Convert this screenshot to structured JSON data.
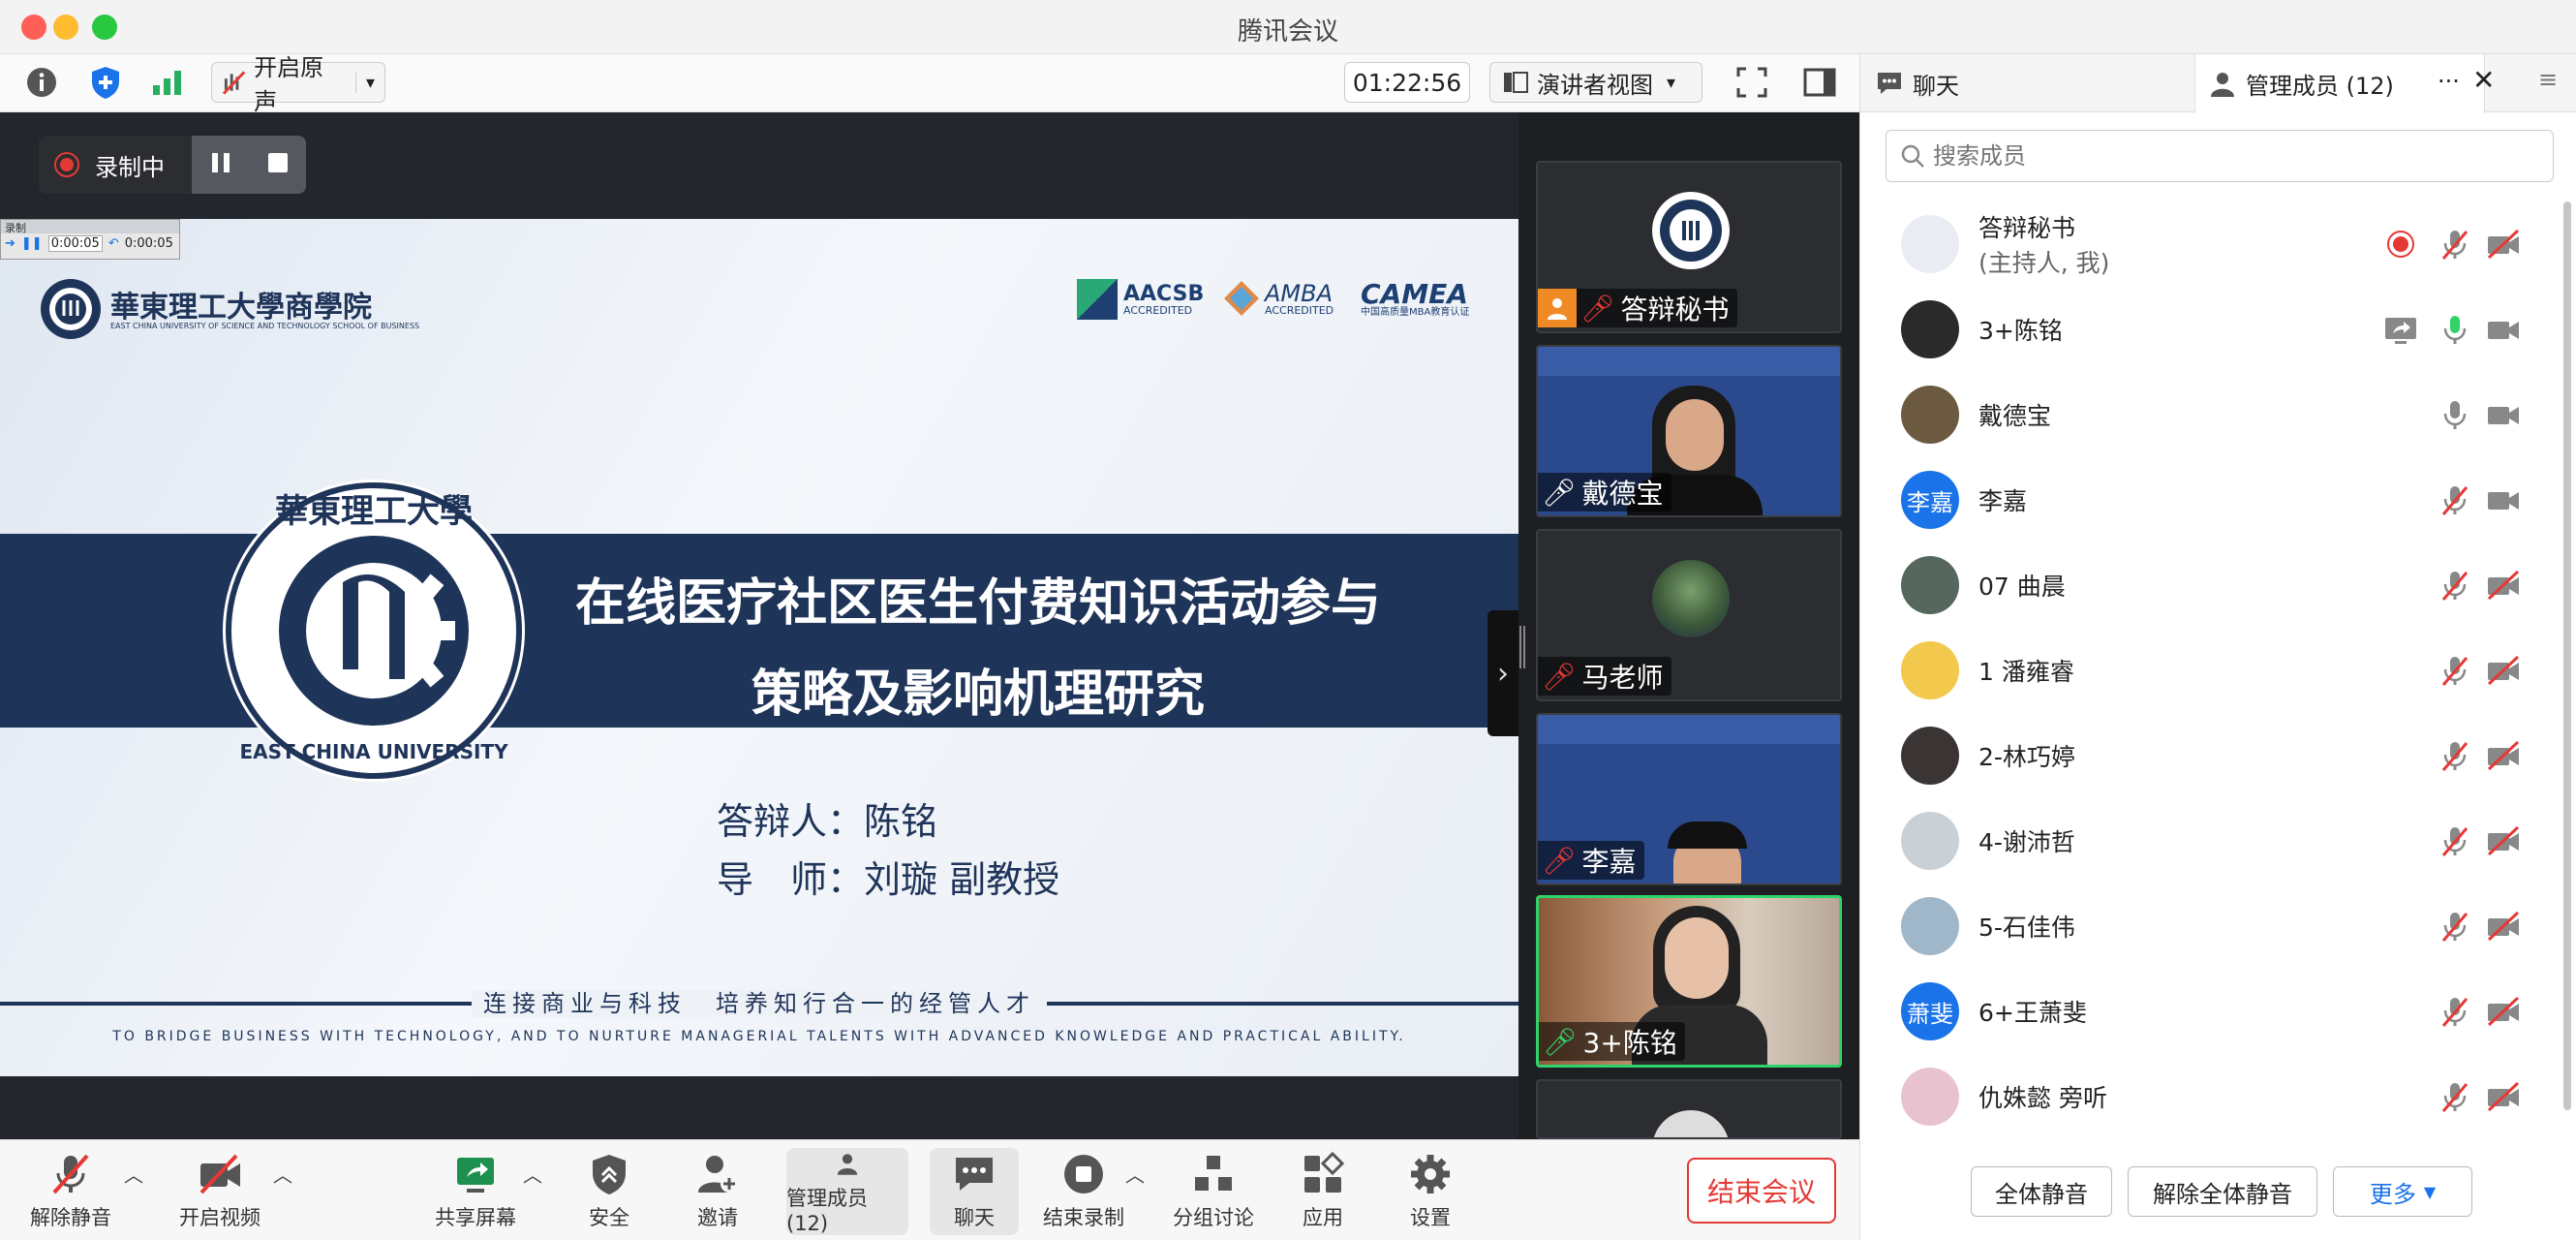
{
  "window": {
    "title": "腾讯会议"
  },
  "toolbar": {
    "original_sound": "开启原声",
    "timer": "01:22:56",
    "view_mode": "演讲者视图"
  },
  "recording": {
    "label": "录制中",
    "mini_label": "录制",
    "mini_time_a": "0:00:05",
    "mini_time_b": "0:00:05"
  },
  "slide": {
    "school_cn": "華東理工大學商學院",
    "school_en": "EAST CHINA UNIVERSITY OF SCIENCE AND TECHNOLOGY SCHOOL OF BUSINESS",
    "logo1": "AACSB",
    "logo1_sub": "ACCREDITED",
    "logo2": "AMBA",
    "logo2_sub": "ACCREDITED",
    "logo3": "CAMEA",
    "logo3_sub": "中国高质量MBA教育认证",
    "title_line1": "在线医疗社区医生付费知识活动参与",
    "title_line2": "策略及影响机理研究",
    "presenter": "答辩人：陈铭",
    "advisor": "导　师：刘璇  副教授",
    "motto_cn": "连接商业与科技　培养知行合一的经管人才",
    "motto_en": "TO BRIDGE BUSINESS WITH TECHNOLOGY, AND TO NURTURE MANAGERIAL TALENTS WITH ADVANCED KNOWLEDGE AND PRACTICAL ABILITY."
  },
  "tiles": [
    {
      "name": "答辩秘书"
    },
    {
      "name": "戴德宝"
    },
    {
      "name": "马老师"
    },
    {
      "name": "李嘉"
    },
    {
      "name": "3+陈铭"
    }
  ],
  "bottom": {
    "unmute": "解除静音",
    "video": "开启视频",
    "share": "共享屏幕",
    "security": "安全",
    "invite": "邀请",
    "members": "管理成员(12)",
    "chat": "聊天",
    "stop_rec": "结束录制",
    "breakout": "分组讨论",
    "apps": "应用",
    "settings": "设置",
    "end": "结束会议"
  },
  "sidebar": {
    "tab_chat": "聊天",
    "tab_members": "管理成员 (12)",
    "search_placeholder": "搜索成员",
    "members": [
      {
        "name": "答辩秘书",
        "sub": "(主持人, 我)",
        "avatar_color": "#e9edf3"
      },
      {
        "name": "3+陈铭",
        "sub": "",
        "avatar_color": "#2a2a2a"
      },
      {
        "name": "戴德宝",
        "sub": "",
        "avatar_color": "#6b5a3f"
      },
      {
        "name": "李嘉",
        "sub": "",
        "avatar_color": "#1a73e8",
        "avatar_text": "李嘉"
      },
      {
        "name": "07 曲晨",
        "sub": "",
        "avatar_color": "#56675e"
      },
      {
        "name": "1 潘雍睿",
        "sub": "",
        "avatar_color": "#f2c94c"
      },
      {
        "name": "2-林巧婷",
        "sub": "",
        "avatar_color": "#3b3434"
      },
      {
        "name": "4-谢沛哲",
        "sub": "",
        "avatar_color": "#c9d1d6"
      },
      {
        "name": "5-石佳伟",
        "sub": "",
        "avatar_color": "#9fb7c9"
      },
      {
        "name": "6+王萧斐",
        "sub": "",
        "avatar_color": "#1a73e8",
        "avatar_text": "萧斐"
      },
      {
        "name": "仇姝懿 旁听",
        "sub": "",
        "avatar_color": "#e8c3cf"
      }
    ],
    "mute_all": "全体静音",
    "unmute_all": "解除全体静音",
    "more": "更多"
  },
  "colors": {
    "end_red": "#e53935",
    "active_green": "#2fd36a",
    "accent_blue": "#1a73e8",
    "slide_navy": "#1f3459"
  }
}
